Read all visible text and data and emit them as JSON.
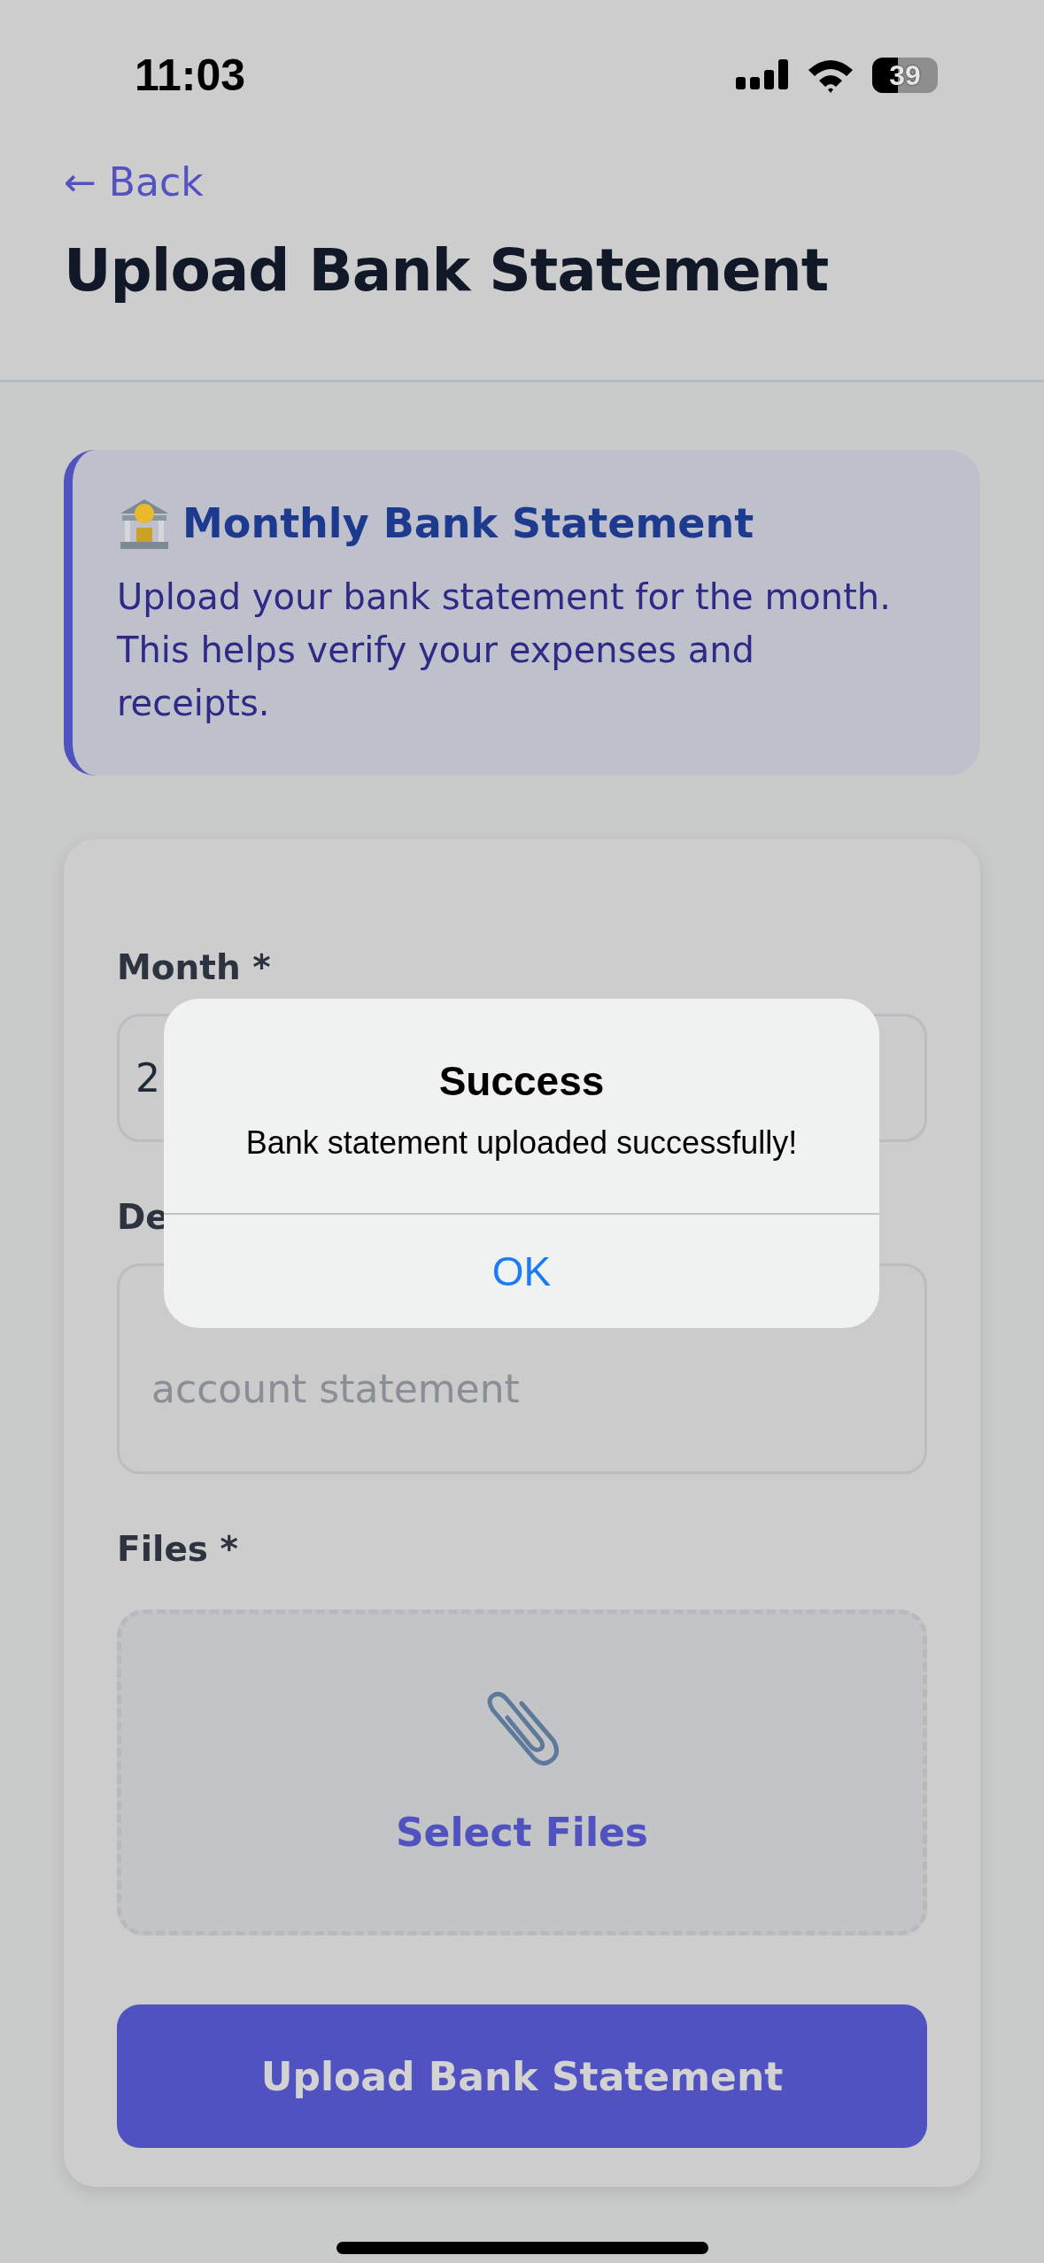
{
  "status_bar": {
    "time": "11:03",
    "battery": "39"
  },
  "header": {
    "back": "← Back",
    "title": "Upload Bank Statement"
  },
  "info_card": {
    "title": "Monthly Bank Statement",
    "text": "Upload your bank statement for the month. This helps verify your expenses and receipts."
  },
  "form": {
    "fields": [
      {
        "kind": "select",
        "label": "Month *",
        "value": "2"
      },
      {
        "kind": "textarea",
        "label": "De",
        "placeholder": "account statement"
      },
      {
        "kind": "files",
        "label": "Files *",
        "button": "Select Files"
      }
    ],
    "submit": "Upload Bank Statement"
  },
  "alert": {
    "title": "Success",
    "message": "Bank statement uploaded successfully!",
    "buttons": [
      "OK"
    ]
  }
}
